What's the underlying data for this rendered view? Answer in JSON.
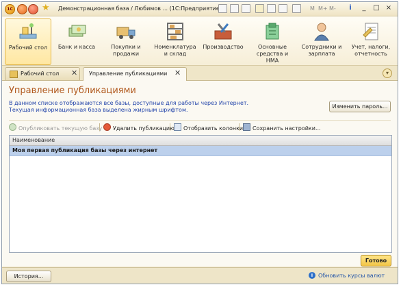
{
  "titlebar": {
    "logo_text": "1С",
    "title": "Демонстрационная база / Любимов ...   (1С:Предприятие)",
    "mem_buttons": [
      "M",
      "M+",
      "M-"
    ],
    "minimize": "_",
    "maximize": "□",
    "close": "×",
    "info": "i"
  },
  "sections": [
    {
      "label": "Рабочий стол",
      "icon": "desk-icon",
      "active": true
    },
    {
      "label": "Банк и касса",
      "icon": "money-icon",
      "active": false
    },
    {
      "label": "Покупки и продажи",
      "icon": "truck-icon",
      "active": false
    },
    {
      "label": "Номенклатура и склад",
      "icon": "shelves-icon",
      "active": false
    },
    {
      "label": "Производство",
      "icon": "tools-icon",
      "active": false
    },
    {
      "label": "Основные средства и НМА",
      "icon": "fixed-assets-icon",
      "active": false
    },
    {
      "label": "Сотрудники и зарплата",
      "icon": "employee-icon",
      "active": false
    },
    {
      "label": "Учет, налоги, отчетность",
      "icon": "reports-icon",
      "active": false
    }
  ],
  "tabs": [
    {
      "label": "Рабочий стол",
      "close": "✕"
    },
    {
      "label": "Управление публикациями",
      "close": "✕"
    }
  ],
  "form": {
    "title": "Управление публикациями",
    "description_line1": "В данном списке отображаются все базы, доступные для работы через Интернет.",
    "description_line2": "Текущая информационная база выделена жирным шрифтом.",
    "change_password_button": "Изменить пароль...",
    "commands": {
      "publish_current": "Опубликовать текущую базу",
      "delete_publication": "Удалить публикацию",
      "show_columns": "Отобразить колонки",
      "save_settings": "Сохранить настройки..."
    },
    "table": {
      "columns": [
        "Наименование"
      ],
      "rows": [
        {
          "name": "Моя первая публикация базы через интернет",
          "selected": true,
          "current": true
        }
      ]
    },
    "done_button": "Готово"
  },
  "statusbar": {
    "history_button": "История...",
    "exchange_rates_link": "Обновить курсы валют"
  }
}
